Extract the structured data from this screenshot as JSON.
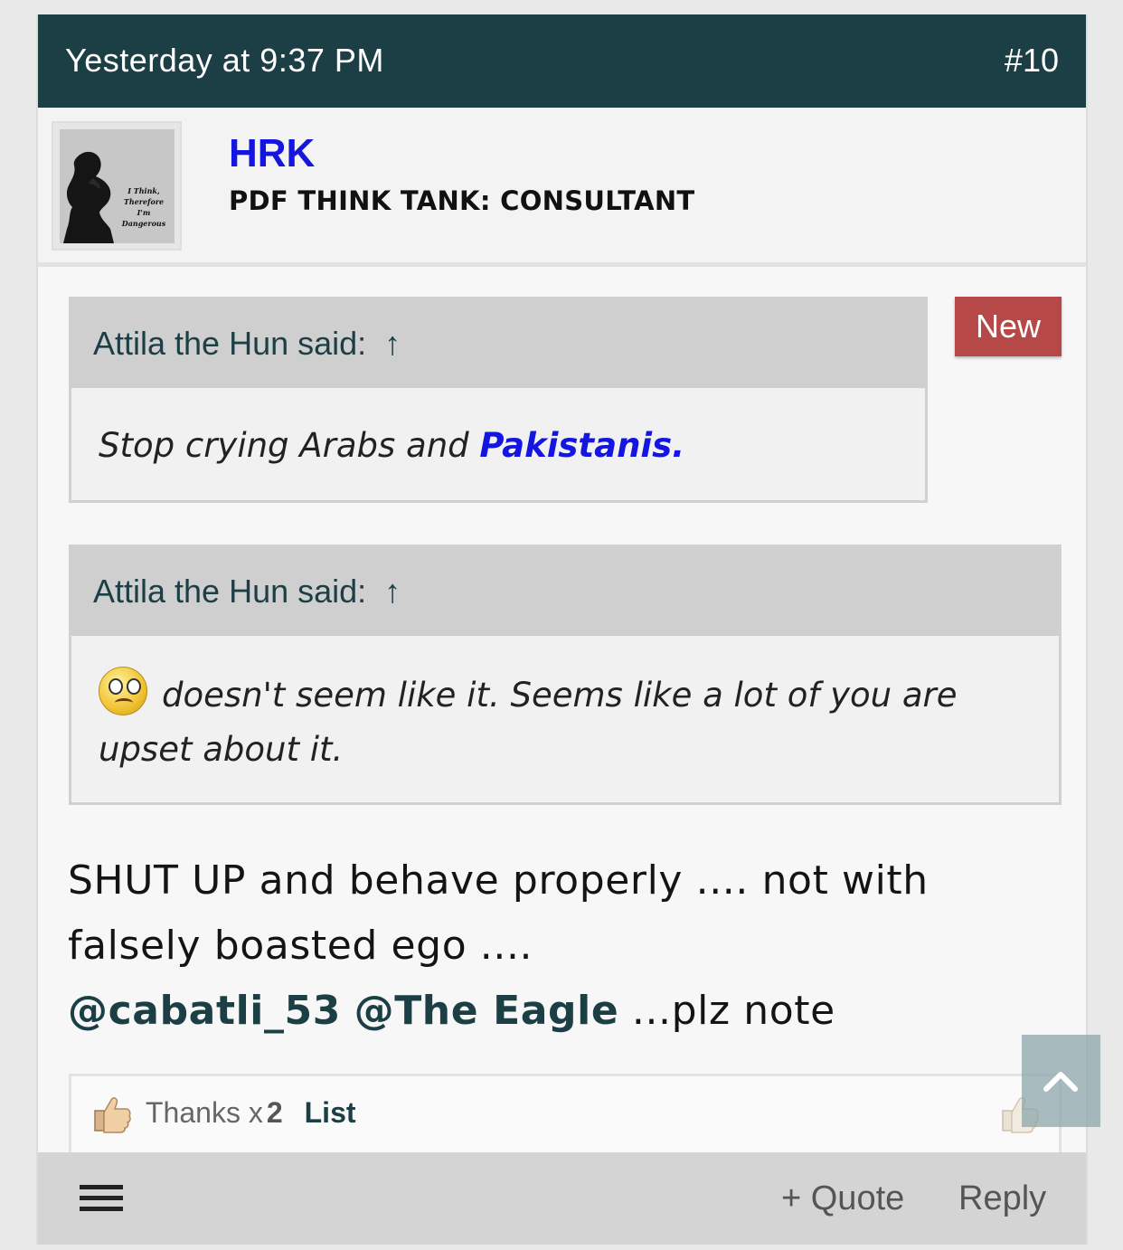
{
  "post": {
    "date": "Yesterday at 9:37 PM",
    "number": "#10"
  },
  "user": {
    "name": "HRK",
    "title": "PDF THINK TANK: CONSULTANT",
    "avatar_text": "I Think, Therefore I'm Dangerous"
  },
  "badge": {
    "new_label": "New"
  },
  "quotes": [
    {
      "author_line": "Attila the Hun said:",
      "arrow": "↑",
      "body_text": "Stop crying Arabs and ",
      "body_link": "Pakistanis."
    },
    {
      "author_line": "Attila the Hun said:",
      "arrow": "↑",
      "emoji": "frown-emoji",
      "body_text": "doesn't seem like it. Seems like a lot of you are upset about it."
    }
  ],
  "message": {
    "line1": "SHUT UP and behave properly .... not with falsely boasted ego ....",
    "mention1": "@cabatli_53",
    "mention2": "@The Eagle",
    "tail": "...plz note"
  },
  "likes": {
    "label": "Thanks x",
    "count": "2",
    "list_label": "List"
  },
  "footer": {
    "quote_label": "+ Quote",
    "reply_label": "Reply"
  },
  "colors": {
    "header_bg": "#1c3f45",
    "username": "#1515e0",
    "new_badge": "#b64848"
  }
}
